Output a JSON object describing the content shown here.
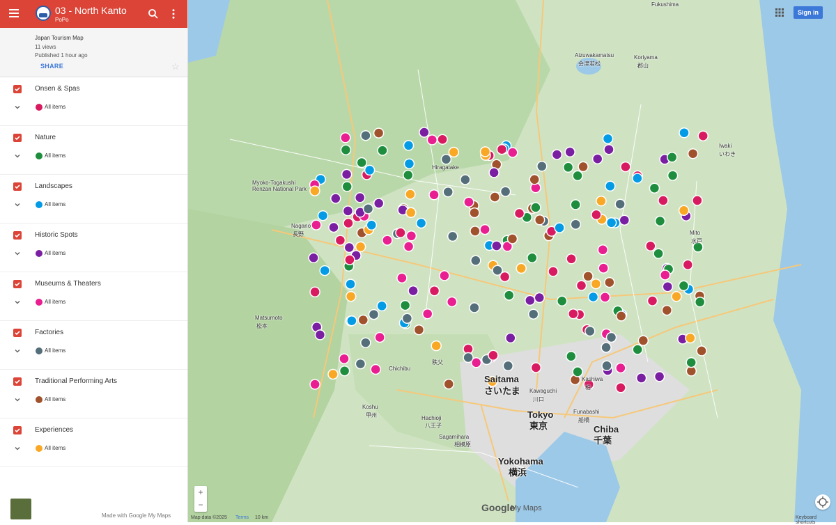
{
  "header": {
    "map_title": "03 - North Kanto",
    "author": "PoPo",
    "menu_icon": "hamburger-menu-icon",
    "search_icon": "search-icon",
    "more_icon": "more-vert-icon"
  },
  "info": {
    "series": "Japan Tourism Map",
    "views": "11 views",
    "published": "Published 1 hour ago",
    "share_label": "SHARE"
  },
  "layers": [
    {
      "name": "Onsen & Spas",
      "items_label": "All items",
      "color": "#d81b60"
    },
    {
      "name": "Nature",
      "items_label": "All items",
      "color": "#1e8e3e"
    },
    {
      "name": "Landscapes",
      "items_label": "All items",
      "color": "#039be5"
    },
    {
      "name": "Historic Spots",
      "items_label": "All items",
      "color": "#7b1fa2"
    },
    {
      "name": "Museums & Theaters",
      "items_label": "All items",
      "color": "#e91e90"
    },
    {
      "name": "Factories",
      "items_label": "All items",
      "color": "#546e7a"
    },
    {
      "name": "Traditional Performing Arts",
      "items_label": "All items",
      "color": "#a0522d"
    },
    {
      "name": "Experiences",
      "items_label": "All items",
      "color": "#f9a825"
    }
  ],
  "footer": {
    "made_with": "Made with Google My Maps"
  },
  "map": {
    "sign_in": "Sign in",
    "zoom_in": "+",
    "zoom_out": "−",
    "attribution": "Map data ©2025",
    "terms": "Terms",
    "scale": "10 km",
    "keyboard": "Keyboard shortcuts",
    "brand": "Google",
    "brand_suffix": "My Maps",
    "places": [
      "Fukushima",
      "Koriyama",
      "郡山",
      "Iwaki",
      "いわき",
      "Nagano",
      "長野",
      "Saitama",
      "さいたま",
      "Tokyo",
      "東京",
      "Chiba",
      "千葉",
      "Yokohama",
      "横浜",
      "Funabashi",
      "船橋",
      "Kashiwa",
      "柏",
      "Kawaguchi",
      "川口",
      "Hachioji",
      "八王子",
      "Sagamihara",
      "相模原",
      "Chichibu",
      "秩父",
      "Matsumoto",
      "松本",
      "Myoko-Togakushi Renzan National Park",
      "Aizuwakamatsu",
      "会津若松",
      "Hiragatake",
      "Koshu",
      "甲州",
      "Mito",
      "水戸"
    ]
  }
}
